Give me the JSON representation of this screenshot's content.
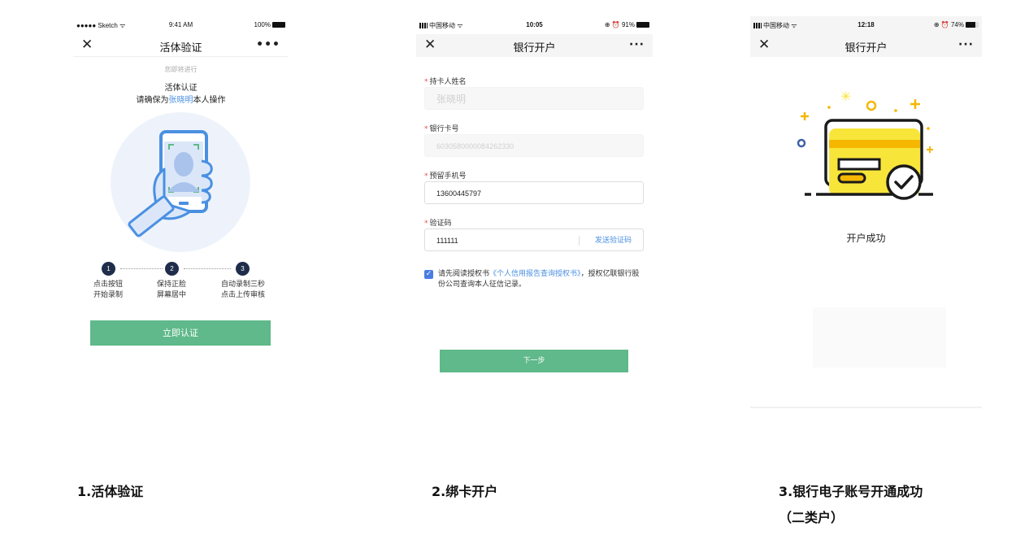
{
  "screens": [
    {
      "status": {
        "left": "●●●●● Sketch ᯤ",
        "time": "9:41 AM",
        "right": "100%"
      },
      "nav": {
        "close": "✕",
        "title": "活体验证",
        "more": "•••"
      },
      "subtitle": "您即将进行",
      "heading": "活体认证",
      "notice_prefix": "请确保为",
      "notice_name": "张晓明",
      "notice_suffix": "本人操作",
      "steps": [
        {
          "num": "1",
          "line1": "点击按钮",
          "line2": "开始录制"
        },
        {
          "num": "2",
          "line1": "保持正脸",
          "line2": "屏幕居中"
        },
        {
          "num": "3",
          "line1": "自动录制三秒",
          "line2": "点击上传审核"
        }
      ],
      "button": "立即认证"
    },
    {
      "status": {
        "left": "中国移动 ᯤ",
        "time": "10:05",
        "right": "⊕ ⏰ 91%"
      },
      "nav": {
        "close": "✕",
        "title": "银行开户",
        "more": "···"
      },
      "fields": [
        {
          "required": "*",
          "label": "持卡人姓名",
          "value": "张晓明"
        },
        {
          "required": "*",
          "label": "银行卡号",
          "value": "6030580000084262330"
        },
        {
          "required": "*",
          "label": "预留手机号",
          "value": "13600445797"
        },
        {
          "required": "*",
          "label": "验证码",
          "value": "111111",
          "action": "发送验证码"
        }
      ],
      "agree_check": "✓",
      "agree_prefix": "请先阅读授权书",
      "agree_link": "《个人信用报告查询授权书》",
      "agree_suffix": "，授权亿联银行股份公司查询本人征信记录。",
      "button": "下一步"
    },
    {
      "status": {
        "left": "中国移动 ᯤ",
        "time": "12:18",
        "right": "⊕ ⏰ 74%"
      },
      "nav": {
        "close": "✕",
        "title": "银行开户",
        "more": "···"
      },
      "success": "开户成功"
    }
  ],
  "captions": [
    "1.活体验证",
    "2.绑卡开户",
    "3.银行电子账号开通成功（二类户）"
  ],
  "colors": {
    "primary_button": "#5fb98a",
    "link": "#4a90e2",
    "required": "#e65050",
    "card_yellow": "#f8e53a",
    "illustration_blue": "#4a90e2",
    "step_badge": "#1f2d4a"
  }
}
